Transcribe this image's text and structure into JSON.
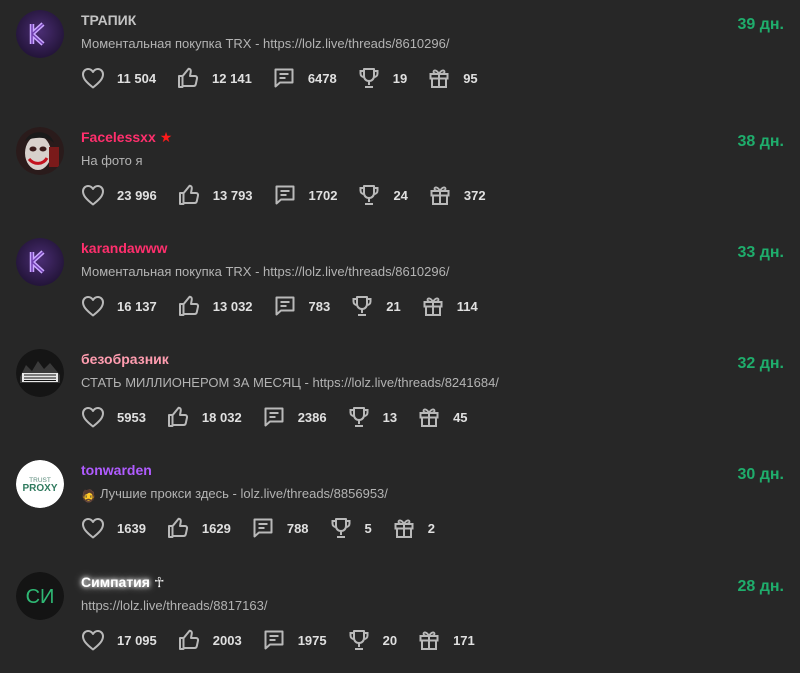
{
  "users": [
    {
      "name": "ТРАПИК",
      "name_color": "#c3c3c3",
      "status": "Моментальная покупка TRX - https://lolz.live/threads/8610296/",
      "days": "39 дн.",
      "avatar": "k-logo-avatar",
      "stats": {
        "likes": "11 504",
        "thumbs": "12 141",
        "messages": "6478",
        "trophies": "19",
        "gifts": "95"
      }
    },
    {
      "name": "Facelessxx",
      "name_color": "#ff2f6d",
      "name_extra": "★",
      "status": "На фото я",
      "days": "38 дн.",
      "avatar": "joker-avatar",
      "stats": {
        "likes": "23 996",
        "thumbs": "13 793",
        "messages": "1702",
        "trophies": "24",
        "gifts": "372"
      }
    },
    {
      "name": "karandawww",
      "name_color": "#ff2f6d",
      "status": "Моментальная покупка TRX - https://lolz.live/threads/8610296/",
      "days": "33 дн.",
      "avatar": "k-logo-avatar",
      "stats": {
        "likes": "16 137",
        "thumbs": "13 032",
        "messages": "783",
        "trophies": "21",
        "gifts": "114"
      }
    },
    {
      "name": "безобразник",
      "name_color": "#ff9db0",
      "status": "СТАТЬ МИЛЛИОНЕРОМ ЗА МЕСЯЦ - https://lolz.live/threads/8241684/",
      "days": "32 дн.",
      "avatar": "dark-logo-avatar",
      "stats": {
        "likes": "5953",
        "thumbs": "18 032",
        "messages": "2386",
        "trophies": "13",
        "gifts": "45"
      }
    },
    {
      "name": "tonwarden",
      "name_color": "#b05cff",
      "status": "Лучшие прокси здесь - lolz.live/threads/8856953/",
      "status_emoji": "🧔",
      "days": "30 дн.",
      "avatar": "trust-proxy-avatar",
      "avatar_text_top": "TRUST",
      "avatar_text_bottom": "PROXY",
      "stats": {
        "likes": "1639",
        "thumbs": "1629",
        "messages": "788",
        "trophies": "5",
        "gifts": "2"
      }
    },
    {
      "name": "Симпатия",
      "name_color": "#ffffff",
      "name_extra": "☥",
      "status": "https://lolz.live/threads/8817163/",
      "days": "28 дн.",
      "avatar": "initials-avatar",
      "avatar_initials": "СИ",
      "stats": {
        "likes": "17 095",
        "thumbs": "2003",
        "messages": "1975",
        "trophies": "20",
        "gifts": "171"
      }
    }
  ],
  "colors": {
    "background": "#272727",
    "days": "#1fad6c",
    "icon": "#b9b9b9",
    "stat_text": "#e0e0e0"
  }
}
